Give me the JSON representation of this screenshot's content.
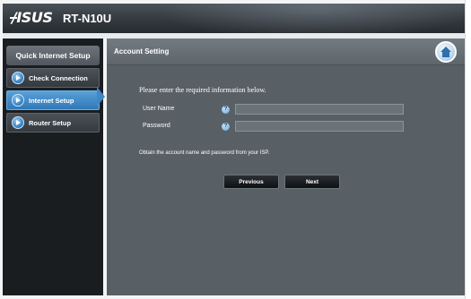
{
  "header": {
    "brand": "/ISUS",
    "model": "RT-N10U"
  },
  "sidebar": {
    "title": "Quick Internet Setup",
    "items": [
      {
        "label": "Check Connection",
        "active": false,
        "icon": "arrow-circle-icon"
      },
      {
        "label": "Internet Setup",
        "active": true,
        "icon": "arrow-circle-icon"
      },
      {
        "label": "Router Setup",
        "active": false,
        "icon": "arrow-circle-icon"
      }
    ]
  },
  "main": {
    "title": "Account Setting",
    "home_icon": "home-icon",
    "prompt": "Please enter the required information below.",
    "fields": {
      "username": {
        "label": "User Name",
        "value": "",
        "placeholder": ""
      },
      "password": {
        "label": "Password",
        "value": "",
        "placeholder": ""
      }
    },
    "help_glyph": "?",
    "note": "Obtain the account name and password from your ISP.",
    "buttons": {
      "previous": "Previous",
      "next": "Next"
    }
  },
  "colors": {
    "accent": "#2f78b8",
    "panel": "#586066",
    "sidebar": "#1a1d20"
  }
}
